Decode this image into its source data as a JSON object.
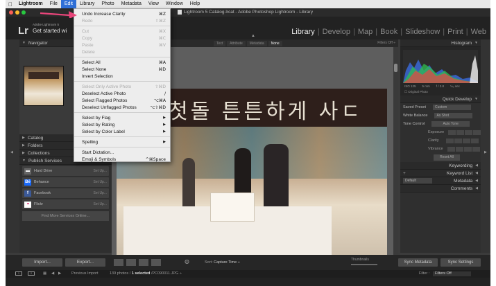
{
  "menubar": {
    "apple": "",
    "items": [
      "Lightroom",
      "File",
      "Edit",
      "Library",
      "Photo",
      "Metadata",
      "View",
      "Window",
      "Help"
    ]
  },
  "window": {
    "title": "Lightroom 5 Catalog.lrcat - Adobe Photoshop Lightroom - Library"
  },
  "identity": {
    "logo": "Lr",
    "adobe": "Adobe Lightroom 5",
    "tagline": "Get started wi"
  },
  "modules": [
    "Library",
    "Develop",
    "Map",
    "Book",
    "Slideshow",
    "Print",
    "Web"
  ],
  "left_panel": {
    "navigator": "Navigator",
    "sections": [
      "Catalog",
      "Folders",
      "Collections"
    ],
    "publish": "Publish Services",
    "services": [
      {
        "name": "Hard Drive",
        "setup": "Set Up...",
        "icon": "hard-drive-icon",
        "color": "#666666"
      },
      {
        "name": "Behance",
        "setup": "Set Up...",
        "icon": "behance-icon",
        "color": "#1769ff",
        "glyph": "Bē"
      },
      {
        "name": "Facebook",
        "setup": "Set Up...",
        "icon": "facebook-icon",
        "color": "#3b5998",
        "glyph": "f"
      },
      {
        "name": "Flickr",
        "setup": "Set Up...",
        "icon": "flickr-icon",
        "color": "#ffffff",
        "glyph": "••"
      }
    ],
    "find_more": "Find More Services Online..."
  },
  "filter_bar": {
    "tabs": [
      "Text",
      "Attribute",
      "Metadata",
      "None"
    ],
    "filters_off": "Filters Off ÷"
  },
  "photo": {
    "banner": "ㅅ 첫돌 튼튼하게 사ㄷ"
  },
  "right_panel": {
    "histogram": "Histogram",
    "histo_info": [
      "ISO 125",
      "5 mm",
      "f / 2.8",
      "⅛₀ sec"
    ],
    "original_photo": "Original Photo",
    "quick_develop": "Quick Develop",
    "saved_preset_label": "Saved Preset",
    "saved_preset_value": "Custom",
    "white_balance_label": "White Balance",
    "white_balance_value": "As Shot",
    "tone_control_label": "Tone Control",
    "auto_tone": "Auto Tone",
    "exposure": "Exposure",
    "clarity": "Clarity",
    "vibrance": "Vibrance",
    "reset_all": "Reset All",
    "keywording": "Keywording",
    "keyword_list": "Keyword List",
    "metadata": "Metadata",
    "metadata_preset": "Default",
    "comments": "Comments"
  },
  "toolbar": {
    "import": "Import...",
    "export": "Export...",
    "sort_label": "Sort:",
    "sort_value": "Capture Time ÷",
    "thumbnails": "Thumbnails",
    "sync_metadata": "Sync Metadata",
    "sync_settings": "Sync Settings"
  },
  "filmstrip": {
    "page1": "1",
    "page2": "2",
    "previous": "Previous Import",
    "count": "139 photos /",
    "selected": "1 selected",
    "filename": "/PC090011.JPG ÷",
    "filter_label": "Filter :",
    "filter_value": "Filters Off"
  },
  "edit_menu": {
    "items": [
      {
        "label": "Undo Increase Clarity",
        "shortcut": "⌘Z",
        "disabled": false
      },
      {
        "label": "Redo",
        "shortcut": "⇧⌘Z",
        "disabled": true
      },
      {
        "sep": true
      },
      {
        "label": "Cut",
        "shortcut": "⌘X",
        "disabled": true
      },
      {
        "label": "Copy",
        "shortcut": "⌘C",
        "disabled": true
      },
      {
        "label": "Paste",
        "shortcut": "⌘V",
        "disabled": true
      },
      {
        "label": "Delete",
        "shortcut": "",
        "disabled": true
      },
      {
        "sep": true
      },
      {
        "label": "Select All",
        "shortcut": "⌘A",
        "disabled": false
      },
      {
        "label": "Select None",
        "shortcut": "⌘D",
        "disabled": false
      },
      {
        "label": "Invert Selection",
        "shortcut": "",
        "disabled": false
      },
      {
        "sep": true
      },
      {
        "label": "Select Only Active Photo",
        "shortcut": "⇧⌘D",
        "disabled": true
      },
      {
        "label": "Deselect Active Photo",
        "shortcut": "/",
        "disabled": false
      },
      {
        "label": "Select Flagged Photos",
        "shortcut": "⌥⌘A",
        "disabled": false
      },
      {
        "label": "Deselect Unflagged Photos",
        "shortcut": "⌥⇧⌘D",
        "disabled": false
      },
      {
        "sep": true
      },
      {
        "label": "Select by Flag",
        "submenu": true
      },
      {
        "label": "Select by Rating",
        "submenu": true
      },
      {
        "label": "Select by Color Label",
        "submenu": true
      },
      {
        "sep": true
      },
      {
        "label": "Spelling",
        "submenu": true
      },
      {
        "sep": true
      },
      {
        "label": "Start Dictation...",
        "shortcut": ""
      },
      {
        "label": "Emoji & Symbols",
        "shortcut": "^⌘Space"
      }
    ]
  },
  "colors": {
    "menu_highlight": "#2f6fd6",
    "annotation_arrow": "#e8457a"
  }
}
